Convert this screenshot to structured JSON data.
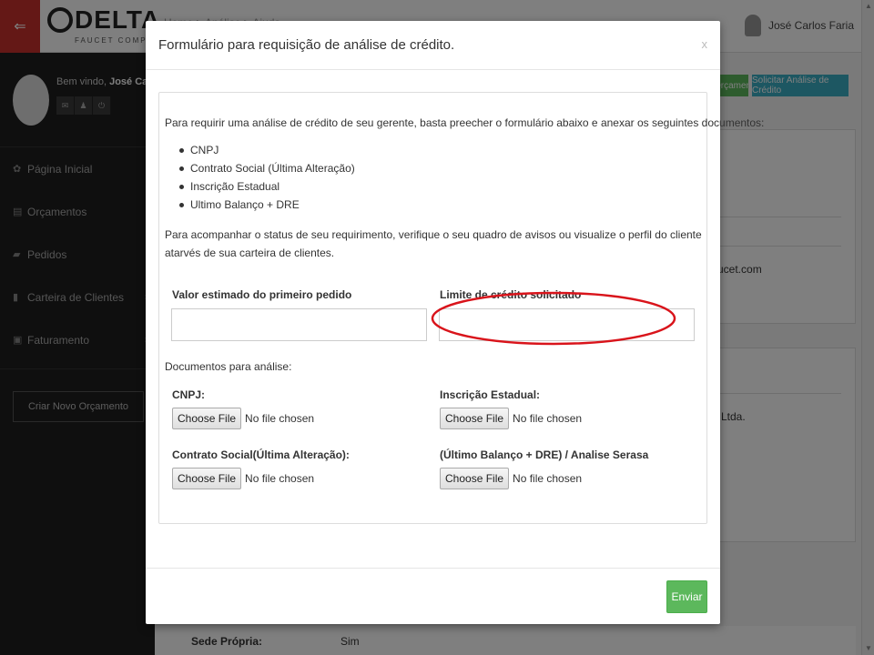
{
  "topbar": {
    "logo_text": "DELTA",
    "logo_sub": "FAUCET COMPANY",
    "breadcrumb": "Home > Análise > Ajuda",
    "user_name": "José Carlos Faria"
  },
  "sidebar": {
    "welcome_prefix": "Bem vindo, ",
    "welcome_name": "José Carlos",
    "items": [
      {
        "label": "Página Inicial",
        "icon": "dashboard-icon"
      },
      {
        "label": "Orçamentos",
        "icon": "document-icon"
      },
      {
        "label": "Pedidos",
        "icon": "truck-icon"
      },
      {
        "label": "Carteira de Clientes",
        "icon": "book-icon"
      },
      {
        "label": "Faturamento",
        "icon": "image-icon"
      }
    ],
    "new_button": "Criar Novo Orçamento"
  },
  "background": {
    "btn_orcamento": "Orçamento",
    "btn_analise": "Solicitar Análise de Crédito",
    "email_fragment": "ucet.com",
    "company_fragment": "Ltda.",
    "row_label": "Sede Própria:",
    "row_value": "Sim"
  },
  "modal": {
    "title": "Formulário para requisição de análise de crédito.",
    "close": "x",
    "intro": "Para requirir uma análise de crédito de seu gerente, basta preecher o formulário abaixo e anexar os seguintes documentos:",
    "documents": [
      "CNPJ",
      "Contrato Social (Última Alteração)",
      "Inscrição Estadual",
      "Ultimo Balanço + DRE"
    ],
    "status_text": "Para acompanhar o status de seu requirimento, verifique o seu quadro de avisos ou visualize o perfil do cliente atarvés de sua carteira de clientes.",
    "field_valor_label": "Valor estimado do primeiro pedido",
    "field_limite_label": "Limite de crédito solicitado",
    "docs_label": "Documentos para análise:",
    "uploads": [
      {
        "label": "CNPJ:",
        "button": "Choose File",
        "status": "No file chosen"
      },
      {
        "label": "Inscrição Estadual:",
        "button": "Choose File",
        "status": "No file chosen"
      },
      {
        "label": "Contrato Social(Última Alteração):",
        "button": "Choose File",
        "status": "No file chosen"
      },
      {
        "label": "(Último Balanço + DRE) / Analise Serasa",
        "button": "Choose File",
        "status": "No file chosen"
      }
    ],
    "submit": "Enviar"
  },
  "colors": {
    "accent_red": "#c9302c",
    "success_green": "#5cb85c",
    "info_blue": "#3bafc4",
    "highlight_ellipse": "#d9141b"
  }
}
